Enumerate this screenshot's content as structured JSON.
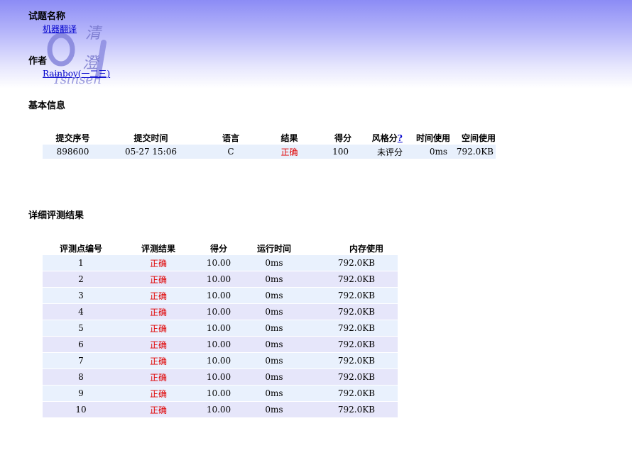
{
  "problem": {
    "heading": "试题名称",
    "name": "机器翻译"
  },
  "author": {
    "heading": "作者",
    "name": "Rainboy(一二三)"
  },
  "logo": {
    "text_main": "清澄",
    "text_sub": "Tsinsen"
  },
  "basic_info": {
    "heading": "基本信息",
    "columns": [
      "提交序号",
      "提交时间",
      "语言",
      "结果",
      "得分",
      "风格分",
      "时间使用",
      "空间使用"
    ],
    "help_mark": "?",
    "row": {
      "submission_id": "898600",
      "time": "05-27 15:06",
      "language": "C",
      "result": "正确",
      "score": "100",
      "style_score": "未评分",
      "time_used": "0ms",
      "memory_used": "792.0KB"
    }
  },
  "detail": {
    "heading": "详细评测结果",
    "columns": [
      "评测点编号",
      "评测结果",
      "得分",
      "运行时间",
      "内存使用"
    ],
    "rows": [
      {
        "id": "1",
        "result": "正确",
        "score": "10.00",
        "time": "0ms",
        "memory": "792.0KB"
      },
      {
        "id": "2",
        "result": "正确",
        "score": "10.00",
        "time": "0ms",
        "memory": "792.0KB"
      },
      {
        "id": "3",
        "result": "正确",
        "score": "10.00",
        "time": "0ms",
        "memory": "792.0KB"
      },
      {
        "id": "4",
        "result": "正确",
        "score": "10.00",
        "time": "0ms",
        "memory": "792.0KB"
      },
      {
        "id": "5",
        "result": "正确",
        "score": "10.00",
        "time": "0ms",
        "memory": "792.0KB"
      },
      {
        "id": "6",
        "result": "正确",
        "score": "10.00",
        "time": "0ms",
        "memory": "792.0KB"
      },
      {
        "id": "7",
        "result": "正确",
        "score": "10.00",
        "time": "0ms",
        "memory": "792.0KB"
      },
      {
        "id": "8",
        "result": "正确",
        "score": "10.00",
        "time": "0ms",
        "memory": "792.0KB"
      },
      {
        "id": "9",
        "result": "正确",
        "score": "10.00",
        "time": "0ms",
        "memory": "792.0KB"
      },
      {
        "id": "10",
        "result": "正确",
        "score": "10.00",
        "time": "0ms",
        "memory": "792.0KB"
      }
    ]
  }
}
